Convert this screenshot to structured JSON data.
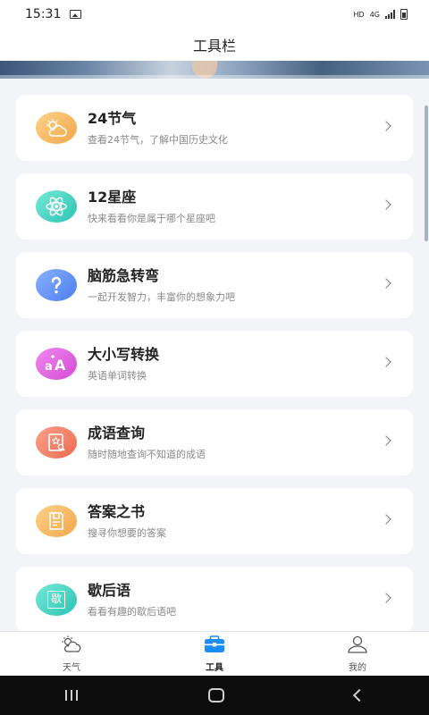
{
  "status_bar": {
    "time": "15:31",
    "hd": "HD",
    "network": "4G"
  },
  "header": {
    "title": "工具栏"
  },
  "tools": [
    {
      "title": "24节气",
      "subtitle": "查看24节气，了解中国历史文化",
      "icon": "cloud-sun-icon",
      "color_from": "#fdd28a",
      "color_to": "#f3a648"
    },
    {
      "title": "12星座",
      "subtitle": "快来看看你是属于哪个星座吧",
      "icon": "atom-icon",
      "color_from": "#74ead6",
      "color_to": "#2cc2b2"
    },
    {
      "title": "脑筋急转弯",
      "subtitle": "一起开发智力，丰富你的想象力吧",
      "icon": "question-icon",
      "color_from": "#8ab0ff",
      "color_to": "#4b7df0"
    },
    {
      "title": "大小写转换",
      "subtitle": "英语单词转换",
      "icon": "letter-case-icon",
      "color_from": "#f089f0",
      "color_to": "#d44ad4"
    },
    {
      "title": "成语查询",
      "subtitle": "随时随地查询不知道的成语",
      "icon": "book-search-icon",
      "color_from": "#fb9f8a",
      "color_to": "#ee6b50"
    },
    {
      "title": "答案之书",
      "subtitle": "搜寻你想要的答案",
      "icon": "answer-book-icon",
      "color_from": "#fdd28a",
      "color_to": "#f3a648"
    },
    {
      "title": "歇后语",
      "subtitle": "看看有趣的歇后语吧",
      "icon": "xie-book-icon",
      "color_from": "#74ead6",
      "color_to": "#2cc2b2",
      "glyph": "歇"
    }
  ],
  "bottom_nav": [
    {
      "label": "天气",
      "icon": "weather-icon"
    },
    {
      "label": "工具",
      "icon": "toolbox-icon",
      "active": true
    },
    {
      "label": "我的",
      "icon": "profile-icon"
    }
  ]
}
